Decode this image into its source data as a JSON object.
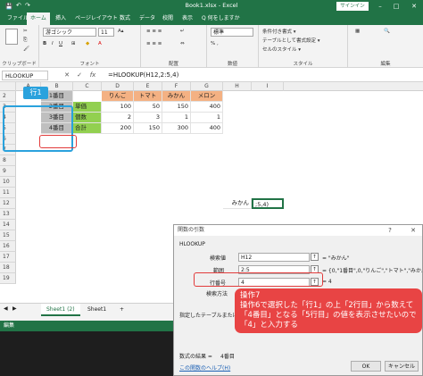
{
  "window": {
    "title": "Book1.xlsx  -  Excel",
    "signin": "サインイン",
    "min": "–",
    "max": "□",
    "close": "✕"
  },
  "ribbon": {
    "tabs": [
      "ファイル",
      "ホーム",
      "挿入",
      "ページレイアウト",
      "数式",
      "データ",
      "校閲",
      "表示",
      "Q 何をしますか"
    ],
    "active_tab": 1,
    "groups": {
      "clipboard": "クリップボード",
      "font": "フォント",
      "alignment": "配置",
      "number": "数値",
      "styles": "スタイル",
      "edit": "編集"
    },
    "font_name": "游ゴシック",
    "font_size": "11",
    "number_format": "標準",
    "styles_items": [
      "条件付き書式 ▾",
      "テーブルとして書式設定 ▾",
      "セルのスタイル ▾"
    ]
  },
  "formula_bar": {
    "name_box": "HLOOKUP",
    "cancel": "✕",
    "enter": "✓",
    "fx": "fx",
    "formula": "=HLOOKUP(H12,2:5,4)"
  },
  "grid": {
    "columns": [
      "A",
      "B",
      "C",
      "D",
      "E",
      "F",
      "G",
      "H",
      "I"
    ],
    "rows": [
      "2",
      "3",
      "4",
      "5",
      "6",
      "7",
      "8",
      "9",
      "10",
      "11",
      "12",
      "13",
      "14",
      "15",
      "16",
      "17",
      "18",
      "19"
    ],
    "row_labels": [
      "1番目",
      "2番目",
      "3番目",
      "4番目"
    ],
    "header_row": [
      "りんご",
      "トマト",
      "みかん",
      "メロン"
    ],
    "category_labels": [
      "単価",
      "個数",
      "合計"
    ],
    "data": [
      [
        100,
        50,
        150,
        400
      ],
      [
        2,
        3,
        1,
        1
      ],
      [
        200,
        150,
        300,
        400
      ]
    ],
    "h12": "みかん",
    "i12": ";5,4)"
  },
  "callouts": {
    "row1_tag": "行1"
  },
  "sheet_tabs": [
    "Sheet1 (2)",
    "Sheet1",
    "+"
  ],
  "status": "編集",
  "dialog": {
    "title": "関数の引数",
    "help_q": "?",
    "close": "✕",
    "func": "HLOOKUP",
    "fields": [
      {
        "label": "検索値",
        "value": "H12",
        "result": "= \"みかん\""
      },
      {
        "label": "範囲",
        "value": "2:5",
        "result": "= {0,\"1番目\",0,\"りんご\",\"トマト\",\"みかん\",\"メ"
      },
      {
        "label": "行番号",
        "value": "4",
        "result": "= 4"
      },
      {
        "label": "検索方法",
        "value": "",
        "result": ""
      }
    ],
    "description": "指定したテーブルまたは配列",
    "result_label": "数式の結果 =",
    "result_value": "4番目",
    "help_link": "この関数のヘルプ(H)",
    "ok": "OK",
    "cancel": "キャンセル"
  },
  "instruction": {
    "title": "操作7",
    "lines": [
      "操作6で選択した「行1」の上「2行目」から数えて",
      "「4番目」となる「5行目」の値を表示させたいので",
      "「4」と入力する"
    ]
  },
  "colors": {
    "excel_green": "#217346",
    "header_fill": "#f4b183",
    "label_fill": "#92d050",
    "row_label_fill": "#bfbfbf",
    "callout_blue": "#2aa2dd",
    "callout_red": "#e84444"
  }
}
